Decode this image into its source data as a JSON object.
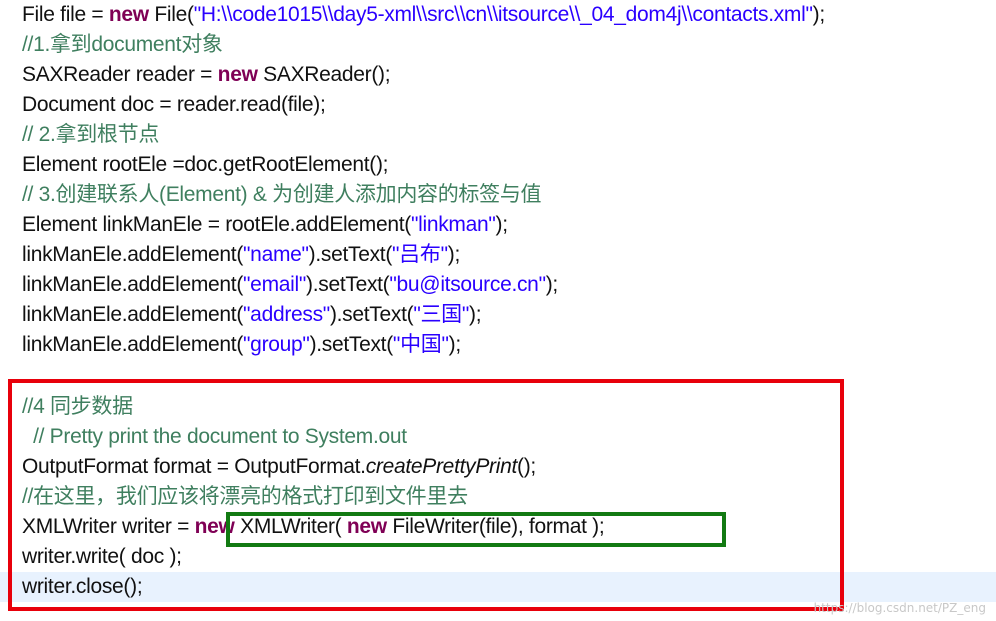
{
  "code_lines": [
    {
      "segments": [
        {
          "t": "plain",
          "v": "File file = "
        },
        {
          "t": "kw",
          "v": "new"
        },
        {
          "t": "plain",
          "v": " File("
        },
        {
          "t": "str",
          "v": "\"H:\\\\code1015\\\\day5-xml\\\\src\\\\cn\\\\itsource\\\\_04_dom4j\\\\contacts.xml\""
        },
        {
          "t": "plain",
          "v": ");"
        }
      ]
    },
    {
      "segments": [
        {
          "t": "cm",
          "v": "//1.拿到document对象"
        }
      ]
    },
    {
      "segments": [
        {
          "t": "plain",
          "v": "SAXReader reader = "
        },
        {
          "t": "kw",
          "v": "new"
        },
        {
          "t": "plain",
          "v": " SAXReader();"
        }
      ]
    },
    {
      "segments": [
        {
          "t": "plain",
          "v": "Document doc = reader.read(file);"
        }
      ]
    },
    {
      "segments": [
        {
          "t": "cm",
          "v": "// 2.拿到根节点"
        }
      ]
    },
    {
      "segments": [
        {
          "t": "plain",
          "v": "Element rootEle =doc.getRootElement();"
        }
      ]
    },
    {
      "segments": [
        {
          "t": "cm",
          "v": "// 3.创建联系人(Element) & 为创建人添加内容的标签与值"
        }
      ]
    },
    {
      "segments": [
        {
          "t": "plain",
          "v": "Element linkManEle = rootEle.addElement("
        },
        {
          "t": "str",
          "v": "\"linkman\""
        },
        {
          "t": "plain",
          "v": ");"
        }
      ]
    },
    {
      "segments": [
        {
          "t": "plain",
          "v": "linkManEle.addElement("
        },
        {
          "t": "str",
          "v": "\"name\""
        },
        {
          "t": "plain",
          "v": ").setText("
        },
        {
          "t": "str",
          "v": "\"吕布\""
        },
        {
          "t": "plain",
          "v": ");"
        }
      ]
    },
    {
      "segments": [
        {
          "t": "plain",
          "v": "linkManEle.addElement("
        },
        {
          "t": "str",
          "v": "\"email\""
        },
        {
          "t": "plain",
          "v": ").setText("
        },
        {
          "t": "str",
          "v": "\"bu@itsource.cn\""
        },
        {
          "t": "plain",
          "v": ");"
        }
      ]
    },
    {
      "segments": [
        {
          "t": "plain",
          "v": "linkManEle.addElement("
        },
        {
          "t": "str",
          "v": "\"address\""
        },
        {
          "t": "plain",
          "v": ").setText("
        },
        {
          "t": "str",
          "v": "\"三国\""
        },
        {
          "t": "plain",
          "v": ");"
        }
      ]
    },
    {
      "segments": [
        {
          "t": "plain",
          "v": "linkManEle.addElement("
        },
        {
          "t": "str",
          "v": "\"group\""
        },
        {
          "t": "plain",
          "v": ").setText("
        },
        {
          "t": "str",
          "v": "\"中国\""
        },
        {
          "t": "plain",
          "v": ");"
        }
      ]
    },
    {
      "segments": [
        {
          "t": "cm",
          "v": "//4 同步数据"
        }
      ]
    },
    {
      "segments": [
        {
          "t": "cm",
          "v": "  // Pretty print the document to System.out"
        }
      ]
    },
    {
      "segments": [
        {
          "t": "plain",
          "v": "OutputFormat format = OutputFormat."
        },
        {
          "t": "it",
          "v": "createPrettyPrint"
        },
        {
          "t": "plain",
          "v": "();"
        }
      ]
    },
    {
      "segments": [
        {
          "t": "cm",
          "v": "//在这里，我们应该将漂亮的格式打印到文件里去"
        }
      ]
    },
    {
      "segments": [
        {
          "t": "plain",
          "v": "XMLWriter writer = "
        },
        {
          "t": "kw",
          "v": "new"
        },
        {
          "t": "plain",
          "v": " XMLWriter( "
        },
        {
          "t": "kw",
          "v": "new"
        },
        {
          "t": "plain",
          "v": " FileWriter(file), format );"
        }
      ]
    },
    {
      "segments": [
        {
          "t": "plain",
          "v": "writer.write( doc );"
        }
      ]
    },
    {
      "segments": [
        {
          "t": "plain",
          "v": "writer.close();"
        }
      ]
    }
  ],
  "watermark": "https://blog.csdn.net/PZ_eng"
}
